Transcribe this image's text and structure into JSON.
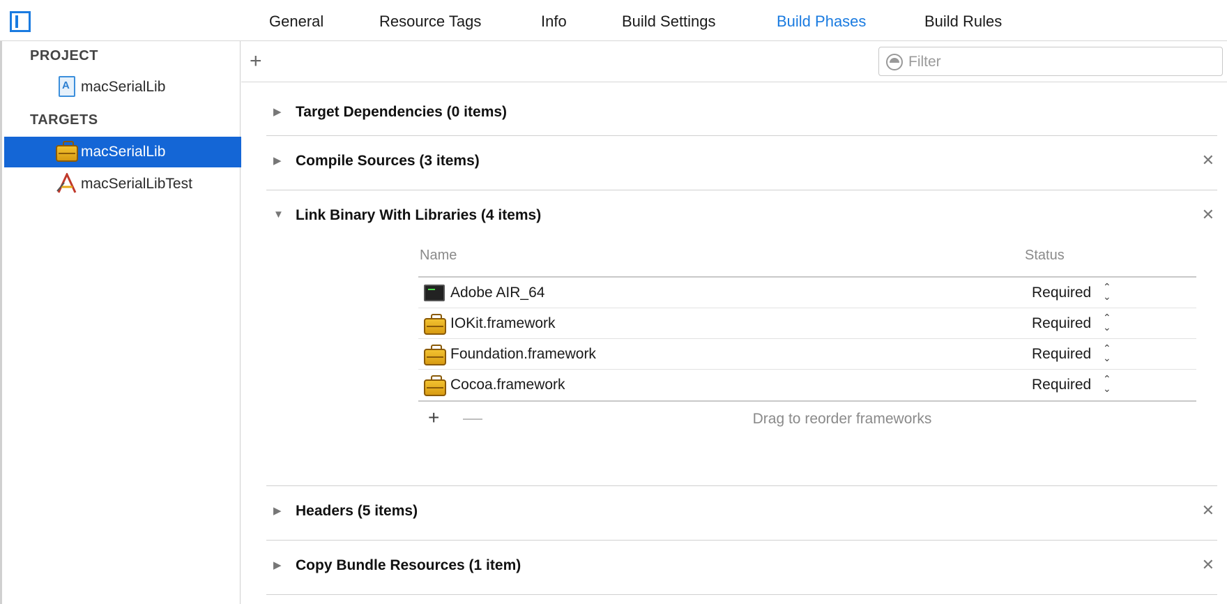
{
  "tabs": [
    {
      "label": "General"
    },
    {
      "label": "Resource Tags"
    },
    {
      "label": "Info"
    },
    {
      "label": "Build Settings"
    },
    {
      "label": "Build Phases",
      "active": true
    },
    {
      "label": "Build Rules"
    }
  ],
  "sidebar": {
    "project_header": "PROJECT",
    "project_item": "macSerialLib",
    "targets_header": "TARGETS",
    "targets": [
      {
        "label": "macSerialLib",
        "icon": "toolbox-icon",
        "selected": true
      },
      {
        "label": "macSerialLibTest",
        "icon": "app-icon",
        "selected": false
      }
    ]
  },
  "toolbar": {
    "add_label": "+",
    "filter_placeholder": "Filter"
  },
  "phases": [
    {
      "title": "Target Dependencies (0 items)",
      "expanded": false,
      "closable": false
    },
    {
      "title": "Compile Sources (3 items)",
      "expanded": false,
      "closable": true
    },
    {
      "title": "Link Binary With Libraries (4 items)",
      "expanded": true,
      "closable": true
    },
    {
      "title": "Headers (5 items)",
      "expanded": false,
      "closable": true
    },
    {
      "title": "Copy Bundle Resources (1 item)",
      "expanded": false,
      "closable": true
    }
  ],
  "libraries": {
    "col_name": "Name",
    "col_status": "Status",
    "rows": [
      {
        "name": "Adobe AIR_64",
        "status": "Required",
        "icon": "terminal-icon"
      },
      {
        "name": "IOKit.framework",
        "status": "Required",
        "icon": "toolbox-icon"
      },
      {
        "name": "Foundation.framework",
        "status": "Required",
        "icon": "toolbox-icon"
      },
      {
        "name": "Cocoa.framework",
        "status": "Required",
        "icon": "toolbox-icon"
      }
    ],
    "add_label": "+",
    "remove_label": "—",
    "hint": "Drag to reorder frameworks"
  },
  "colors": {
    "accent": "#1a7be0",
    "selection": "#1466d6"
  }
}
